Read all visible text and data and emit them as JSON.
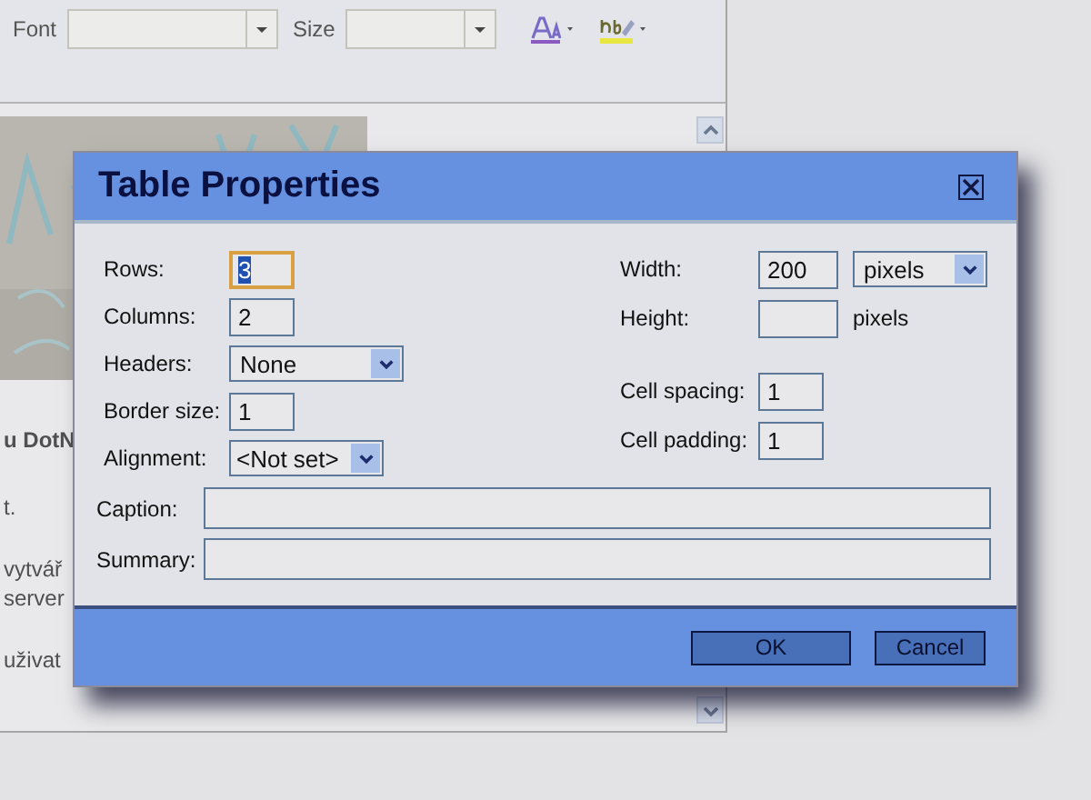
{
  "toolbar": {
    "font_label": "Font",
    "size_label": "Size"
  },
  "document": {
    "paragraphs": [
      {
        "lines": [
          "u DotN"
        ],
        "bold": true
      },
      {
        "lines": [
          "t."
        ],
        "bold": false
      },
      {
        "lines": [
          "vytvář",
          "server"
        ],
        "bold": false
      },
      {
        "lines": [
          "uživat"
        ],
        "bold": false
      }
    ]
  },
  "dialog": {
    "title": "Table Properties",
    "left_fields": [
      {
        "label": "Rows:",
        "kind": "input",
        "value": "3",
        "focused": true
      },
      {
        "label": "Columns:",
        "kind": "input",
        "value": "2",
        "focused": false
      },
      {
        "label": "Headers:",
        "kind": "select",
        "value": "None"
      },
      {
        "label": "Border size:",
        "kind": "input",
        "value": "1",
        "focused": false
      },
      {
        "label": "Alignment:",
        "kind": "select",
        "value": "<Not set>"
      }
    ],
    "right_groups": [
      [
        {
          "label": "Width:",
          "kind": "input_select",
          "value": "200",
          "unit": "pixels"
        },
        {
          "label": "Height:",
          "kind": "input_text",
          "unit": "pixels"
        }
      ],
      [
        {
          "label": "Cell spacing:",
          "kind": "input",
          "value": "1",
          "focused": false
        },
        {
          "label": "Cell padding:",
          "kind": "input",
          "value": "1",
          "focused": false
        }
      ]
    ],
    "wide_fields": [
      {
        "label": "Caption:"
      },
      {
        "label": "Summary:"
      }
    ],
    "buttons": [
      {
        "label": "OK",
        "kind": "wide"
      },
      {
        "label": "Cancel",
        "kind": "narrow"
      }
    ]
  }
}
